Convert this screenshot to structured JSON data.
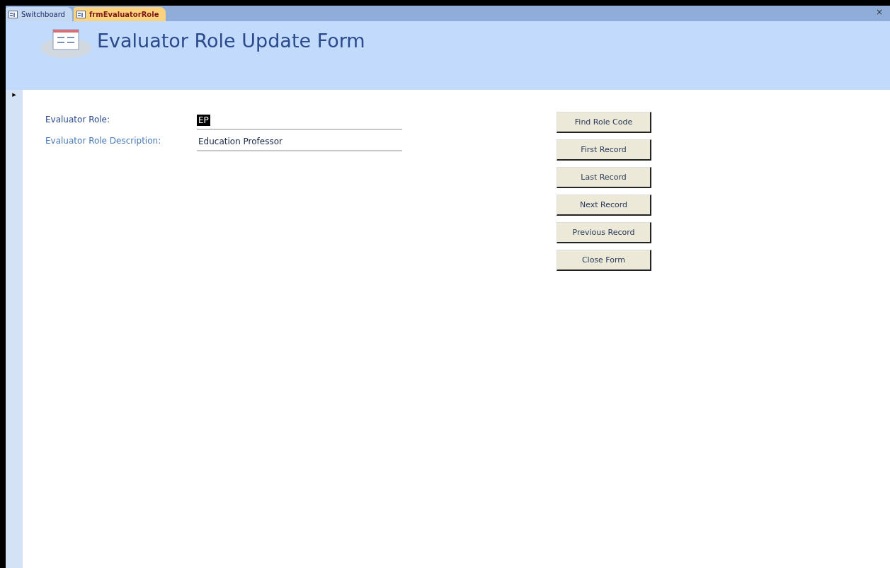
{
  "tabs": [
    {
      "label": "Switchboard",
      "selected": false
    },
    {
      "label": "frmEvaluatorRole",
      "selected": true
    }
  ],
  "close_glyph": "×",
  "form": {
    "title": "Evaluator Role Update Form",
    "fields": [
      {
        "label": "Evaluator Role:",
        "value": "EP",
        "selected": true
      },
      {
        "label": "Evaluator Role Description:",
        "value": "Education Professor",
        "selected": false
      }
    ],
    "buttons": [
      "Find Role Code",
      "First Record",
      "Last Record",
      "Next Record",
      "Previous Record",
      "Close Form"
    ]
  },
  "record_selector": "▸"
}
